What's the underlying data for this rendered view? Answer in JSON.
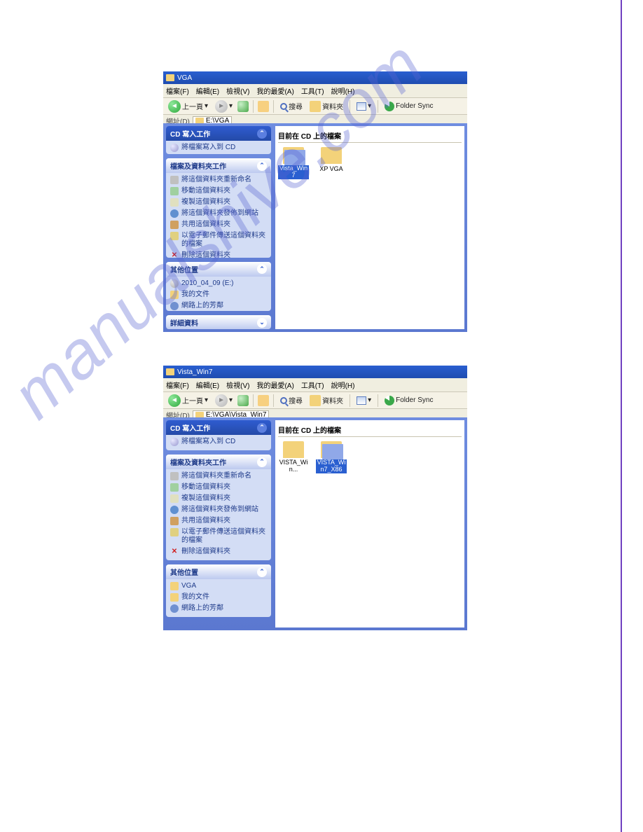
{
  "watermark": "manualshive.com",
  "windows": [
    {
      "title": "VGA",
      "menubar": [
        "檔案(F)",
        "編輯(E)",
        "檢視(V)",
        "我的最愛(A)",
        "工具(T)",
        "說明(H)"
      ],
      "toolbar": {
        "back_label": "上一頁",
        "search_label": "搜尋",
        "folders_label": "資料夾",
        "sync_label": "Folder Sync"
      },
      "address": {
        "label": "網址(D)",
        "path": "E:\\VGA"
      },
      "panels": {
        "cd": {
          "title": "CD 寫入工作",
          "items": [
            "將檔案寫入到 CD"
          ]
        },
        "file": {
          "title": "檔案及資料夾工作",
          "items": [
            "將這個資料夾重新命名",
            "移動這個資料夾",
            "複製這個資料夾",
            "將這個資料夾發佈到網站",
            "共用這個資料夾",
            "以電子郵件傳送這個資料夾的檔案",
            "刪除這個資料夾"
          ]
        },
        "other": {
          "title": "其他位置",
          "items": [
            "2010_04_09 (E:)",
            "我的文件",
            "網路上的芳鄰"
          ]
        },
        "details": {
          "title": "詳細資料"
        }
      },
      "content": {
        "header": "目前在 CD 上的檔案",
        "items": [
          {
            "label": "Vista_Win7",
            "selected": true,
            "open": true
          },
          {
            "label": "XP VGA",
            "selected": false,
            "open": false
          }
        ]
      }
    },
    {
      "title": "Vista_Win7",
      "menubar": [
        "檔案(F)",
        "編輯(E)",
        "檢視(V)",
        "我的最愛(A)",
        "工具(T)",
        "說明(H)"
      ],
      "toolbar": {
        "back_label": "上一頁",
        "search_label": "搜尋",
        "folders_label": "資料夾",
        "sync_label": "Folder Sync"
      },
      "address": {
        "label": "網址(D)",
        "path": "E:\\VGA\\Vista_Win7"
      },
      "panels": {
        "cd": {
          "title": "CD 寫入工作",
          "items": [
            "將檔案寫入到 CD"
          ]
        },
        "file": {
          "title": "檔案及資料夾工作",
          "items": [
            "將這個資料夾重新命名",
            "移動這個資料夾",
            "複製這個資料夾",
            "將這個資料夾發佈到網站",
            "共用這個資料夾",
            "以電子郵件傳送這個資料夾的檔案",
            "刪除這個資料夾"
          ]
        },
        "other": {
          "title": "其他位置",
          "items": [
            "VGA",
            "我的文件",
            "網路上的芳鄰"
          ]
        }
      },
      "content": {
        "header": "目前在 CD 上的檔案",
        "items": [
          {
            "label": "VISTA_Win...",
            "selected": false,
            "open": false
          },
          {
            "label": "VISTA_Win7_X86",
            "selected": true,
            "open": true
          }
        ]
      }
    }
  ]
}
